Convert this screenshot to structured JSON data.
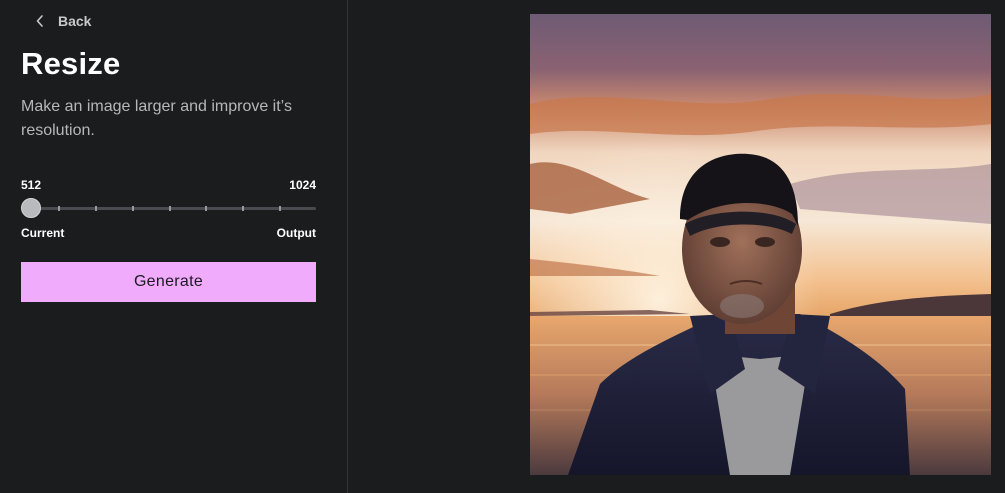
{
  "nav": {
    "back_label": "Back"
  },
  "page": {
    "title": "Resize",
    "description": "Make an image larger and improve it’s resolution."
  },
  "slider": {
    "min_label": "512",
    "max_label": "1024",
    "current_label": "Current",
    "output_label": "Output",
    "value_fraction": 0,
    "tick_count": 7
  },
  "actions": {
    "generate_label": "Generate"
  },
  "preview": {
    "image_subject": "portrait of an elderly man in a cap at sunset by the sea"
  },
  "colors": {
    "background": "#1b1c1e",
    "accent": "#f0abfc",
    "divider": "#34353a"
  },
  "icons": {
    "back": "chevron-left-icon"
  }
}
